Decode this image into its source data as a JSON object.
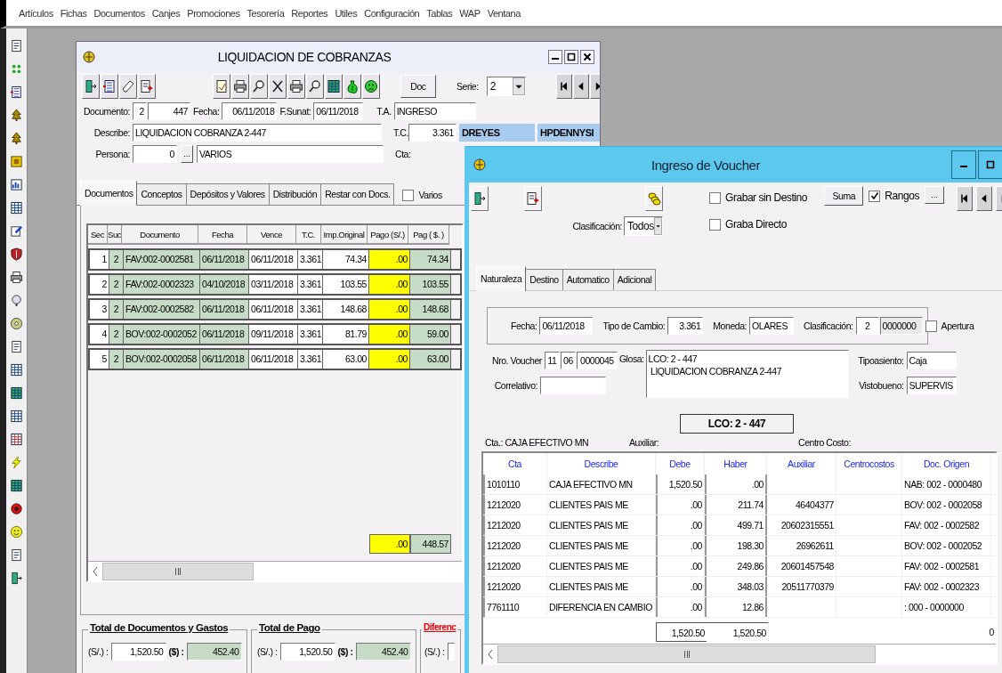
{
  "menu": [
    "Artículos",
    "Fichas",
    "Documentos",
    "Canjes",
    "Promociones",
    "Tesorería",
    "Reportes",
    "Utiles",
    "Configuración",
    "Tablas",
    "WAP",
    "Ventana"
  ],
  "liquidacion": {
    "title": "LIQUIDACION DE COBRANZAS",
    "doc_button": "Doc",
    "serie": {
      "label": "Serie:",
      "value": "2"
    },
    "documento": {
      "label": "Documento:",
      "serie": "2",
      "numero": "447"
    },
    "fecha": {
      "label": "Fecha:",
      "value": "06/11/2018"
    },
    "f_sunat": {
      "label": "F.Sunat:",
      "value": "06/11/2018"
    },
    "ta": {
      "label": "T.A.",
      "value": "INGRESO"
    },
    "describe": {
      "label": "Describe:",
      "value": "LIQUIDACION COBRANZA 2-447"
    },
    "tc": {
      "label": "T.C.",
      "value": "3.361"
    },
    "user": "DREYES",
    "host": "HPDENNYSI",
    "persona": {
      "label": "Persona:",
      "code": "0",
      "button": "...",
      "name": "VARIOS"
    },
    "cta": {
      "label": "Cta:"
    },
    "tabs": [
      {
        "label": "Documentos",
        "selected": true
      },
      {
        "label": "Conceptos",
        "selected": false
      },
      {
        "label": "Depósitos y Valores",
        "selected": false
      },
      {
        "label": "Distribución",
        "selected": false
      },
      {
        "label": "Restar con Docs.",
        "selected": false
      }
    ],
    "varios": {
      "label": "Varios",
      "checked": false
    },
    "table": {
      "columns": [
        "Sec",
        "Suc",
        "Documento",
        "Fecha",
        "Vence",
        "T.C.",
        "Imp.Original",
        "Pago (S/.)",
        "Pag ( $. )"
      ],
      "rows": [
        {
          "sec": "1",
          "suc": "2",
          "documento": "FAV:002-0002581",
          "fecha": "06/11/2018",
          "vence": "06/11/2018",
          "tc": "3.361",
          "imp_original": "74.34",
          "pago_soles": ".00",
          "pag_dolares": "74.34"
        },
        {
          "sec": "2",
          "suc": "2",
          "documento": "FAV:002-0002323",
          "fecha": "04/10/2018",
          "vence": "03/11/2018",
          "tc": "3.361",
          "imp_original": "103.55",
          "pago_soles": ".00",
          "pag_dolares": "103.55"
        },
        {
          "sec": "3",
          "suc": "2",
          "documento": "FAV:002-0002582",
          "fecha": "06/11/2018",
          "vence": "06/11/2018",
          "tc": "3.361",
          "imp_original": "148.68",
          "pago_soles": ".00",
          "pag_dolares": "148.68"
        },
        {
          "sec": "4",
          "suc": "2",
          "documento": "BOV:002-0002052",
          "fecha": "06/11/2018",
          "vence": "09/11/2018",
          "tc": "3.361",
          "imp_original": "81.79",
          "pago_soles": ".00",
          "pag_dolares": "59.00"
        },
        {
          "sec": "5",
          "suc": "2",
          "documento": "BOV:002-0002058",
          "fecha": "06/11/2018",
          "vence": "06/11/2018",
          "tc": "3.361",
          "imp_original": "63.00",
          "pago_soles": ".00",
          "pag_dolares": "63.00"
        }
      ],
      "totals": {
        "pago_soles": ".00",
        "pag_dolares": "448.57"
      }
    },
    "summary": [
      {
        "kind": "total",
        "title": "Total de Documentos y Gastos",
        "soles_label": "(S/.) :",
        "soles": "1,520.50",
        "dolares_label": "($) :",
        "dolares": "452.40"
      },
      {
        "kind": "total",
        "title": "Total de Pago",
        "soles_label": "(S/.) :",
        "soles": "1,520.50",
        "dolares_label": "($) :",
        "dolares": "452.40"
      },
      {
        "kind": "difference",
        "title": "Diferenc",
        "soles_label": "(S/.) :"
      }
    ]
  },
  "voucher": {
    "title": "Ingreso de Voucher",
    "grabar_sin_destino": {
      "label": "Grabar sin Destino",
      "checked": false
    },
    "graba_directo": {
      "label": "Graba Directo",
      "checked": false
    },
    "suma_button": "Suma",
    "rangos": {
      "label": "Rangos",
      "checked": true
    },
    "more_button": "...",
    "clasificacion": {
      "label": "Clasificación:",
      "value": "Todos"
    },
    "tabs": [
      {
        "label": "Naturaleza",
        "selected": true
      },
      {
        "label": "Destino",
        "selected": false
      },
      {
        "label": "Automatico",
        "selected": false
      },
      {
        "label": "Adicional",
        "selected": false
      }
    ],
    "fecha": {
      "label": "Fecha:",
      "value": "06/11/2018"
    },
    "tipo_cambio": {
      "label": "Tipo de Cambio:",
      "value": "3.361"
    },
    "moneda": {
      "label": "Moneda:",
      "value": "OLARES"
    },
    "clasificacion_field": {
      "label": "Clasificación:",
      "code": "2",
      "number": "0000000"
    },
    "apertura": {
      "label": "Apertura",
      "checked": false
    },
    "nro_voucher": {
      "label": "Nro. Voucher",
      "parts": [
        "11",
        "06",
        "0000045"
      ]
    },
    "correlativo": {
      "label": "Correlativo:"
    },
    "glosa": {
      "label": "Glosa:",
      "lines": [
        "LCO: 2 - 447",
        " LIQUIDACION COBRANZA 2-447"
      ]
    },
    "tipoasiento": {
      "label": "Tipoasiento:",
      "value": "Caja"
    },
    "vistobueno": {
      "label": "Vistobueno:",
      "value": "SUPERVIS"
    },
    "reference": "LCO: 2 - 447",
    "cta_info": "Cta.: CAJA EFECTIVO MN",
    "auxiliar_label": "Auxiliar:",
    "centro_costo_label": "Centro Costo:",
    "grid": {
      "columns": [
        "Cta",
        "Describe",
        "Debe",
        "Haber",
        "Auxiliar",
        "Centrocostos",
        "Doc. Origen"
      ],
      "rows": [
        {
          "cta": "1010110",
          "describe": "CAJA EFECTIVO MN",
          "debe": "1,520.50",
          "haber": ".00",
          "doc_origen": "NAB: 002 - 0000480"
        },
        {
          "cta": "1212020",
          "describe": "CLIENTES PAIS ME",
          "debe": ".00",
          "haber": "211.74",
          "auxiliar": "46404377",
          "doc_origen": "BOV: 002 - 0002058"
        },
        {
          "cta": "1212020",
          "describe": "CLIENTES PAIS ME",
          "debe": ".00",
          "haber": "499.71",
          "auxiliar": "20602315551",
          "doc_origen": "FAV: 002 - 0002582"
        },
        {
          "cta": "1212020",
          "describe": "CLIENTES PAIS ME",
          "debe": ".00",
          "haber": "198.30",
          "auxiliar": "26962611",
          "doc_origen": "BOV: 002 - 0002052"
        },
        {
          "cta": "1212020",
          "describe": "CLIENTES PAIS ME",
          "debe": ".00",
          "haber": "249.86",
          "auxiliar": "20601457548",
          "doc_origen": "FAV: 002 - 0002581"
        },
        {
          "cta": "1212020",
          "describe": "CLIENTES PAIS ME",
          "debe": ".00",
          "haber": "348.03",
          "auxiliar": "20511770379",
          "doc_origen": "FAV: 002 - 0002323"
        },
        {
          "cta": "7761110",
          "describe": "DIFERENCIA EN CAMBIO",
          "debe": ".00",
          "haber": "12.86",
          "doc_origen": ": 000 - 0000000"
        }
      ],
      "totals": {
        "debe": "1,520.50",
        "haber": "1,520.50",
        "column_8": "0"
      }
    }
  }
}
